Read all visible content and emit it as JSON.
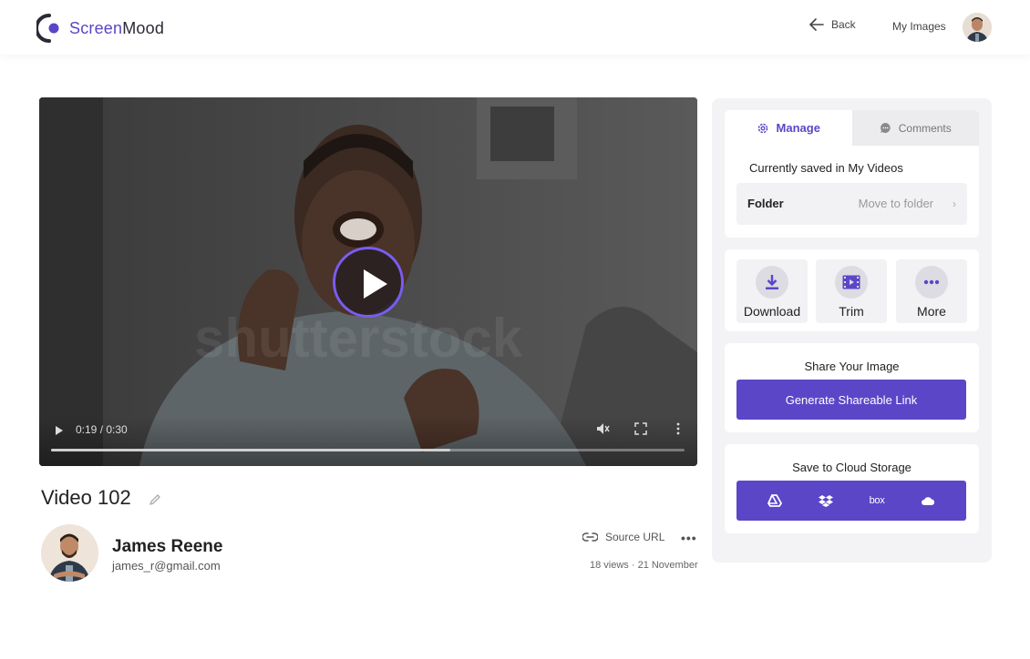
{
  "header": {
    "brand_primary": "Screen",
    "brand_secondary": "Mood",
    "back_label": "Back",
    "my_images_label": "My Images"
  },
  "video": {
    "current_time": "0:19",
    "duration": "0:30",
    "time_display": "0:19 / 0:30",
    "progress_fraction": 0.63,
    "watermark": "shutterstock"
  },
  "details": {
    "title": "Video 102",
    "author_name": "James Reene",
    "author_email": "james_r@gmail.com",
    "source_label": "Source URL",
    "stats": "18 views · 21 November"
  },
  "panel": {
    "tabs": [
      {
        "label": "Manage",
        "active": true
      },
      {
        "label": "Comments",
        "active": false
      }
    ],
    "saved_text": "Currently saved in My Videos",
    "folder_label": "Folder",
    "folder_action": "Move to folder",
    "actions": [
      {
        "label": "Download",
        "icon": "download-icon"
      },
      {
        "label": "Trim",
        "icon": "film-icon"
      },
      {
        "label": "More",
        "icon": "more-icon"
      }
    ],
    "share_title": "Share Your Image",
    "share_button": "Generate Shareable Link",
    "cloud_title": "Save to Cloud Storage",
    "cloud_services": [
      "google-drive",
      "dropbox",
      "box",
      "onedrive"
    ],
    "box_label": "box"
  },
  "colors": {
    "accent": "#5b46c8",
    "play_ring": "#7a5cf0"
  }
}
